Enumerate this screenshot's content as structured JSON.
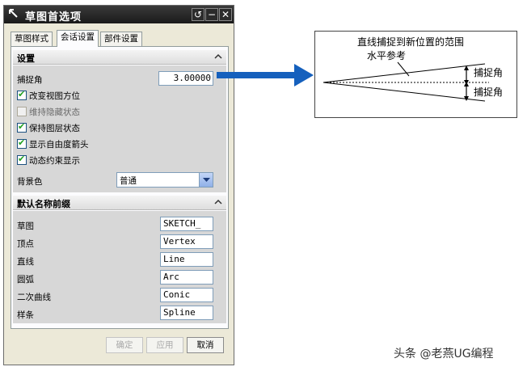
{
  "dialog": {
    "title": "草图首选项",
    "title_buttons": [
      "↺",
      "−",
      "✕"
    ],
    "tabs": [
      {
        "label": "草图样式",
        "active": false
      },
      {
        "label": "会话设置",
        "active": true
      },
      {
        "label": "部件设置",
        "active": false
      }
    ],
    "settings": {
      "header": "设置",
      "snap_angle_label": "捕捉角",
      "snap_angle_value": "3.00000",
      "checkboxes": [
        {
          "label": "改变视图方位",
          "checked": true,
          "disabled": false
        },
        {
          "label": "维持隐藏状态",
          "checked": false,
          "disabled": true
        },
        {
          "label": "保持图层状态",
          "checked": true,
          "disabled": false
        },
        {
          "label": "显示自由度箭头",
          "checked": true,
          "disabled": false
        },
        {
          "label": "动态约束显示",
          "checked": true,
          "disabled": false
        }
      ],
      "background_label": "背景色",
      "background_value": "普通"
    },
    "name_prefix": {
      "header": "默认名称前缀",
      "items": [
        {
          "label": "草图",
          "value": "SKETCH_"
        },
        {
          "label": "顶点",
          "value": "Vertex"
        },
        {
          "label": "直线",
          "value": "Line"
        },
        {
          "label": "圆弧",
          "value": "Arc"
        },
        {
          "label": "二次曲线",
          "value": "Conic"
        },
        {
          "label": "样条",
          "value": "Spline"
        }
      ]
    },
    "buttons": {
      "ok": "确定",
      "apply": "应用",
      "cancel": "取消"
    }
  },
  "diagram": {
    "caption_line1": "直线捕捉到新位置的范围",
    "caption_line2": "水平参考",
    "angle_label_top": "捕捉角",
    "angle_label_bottom": "捕捉角",
    "arrow_color": "#1560bd"
  },
  "watermark": "头条 @老燕UG编程"
}
